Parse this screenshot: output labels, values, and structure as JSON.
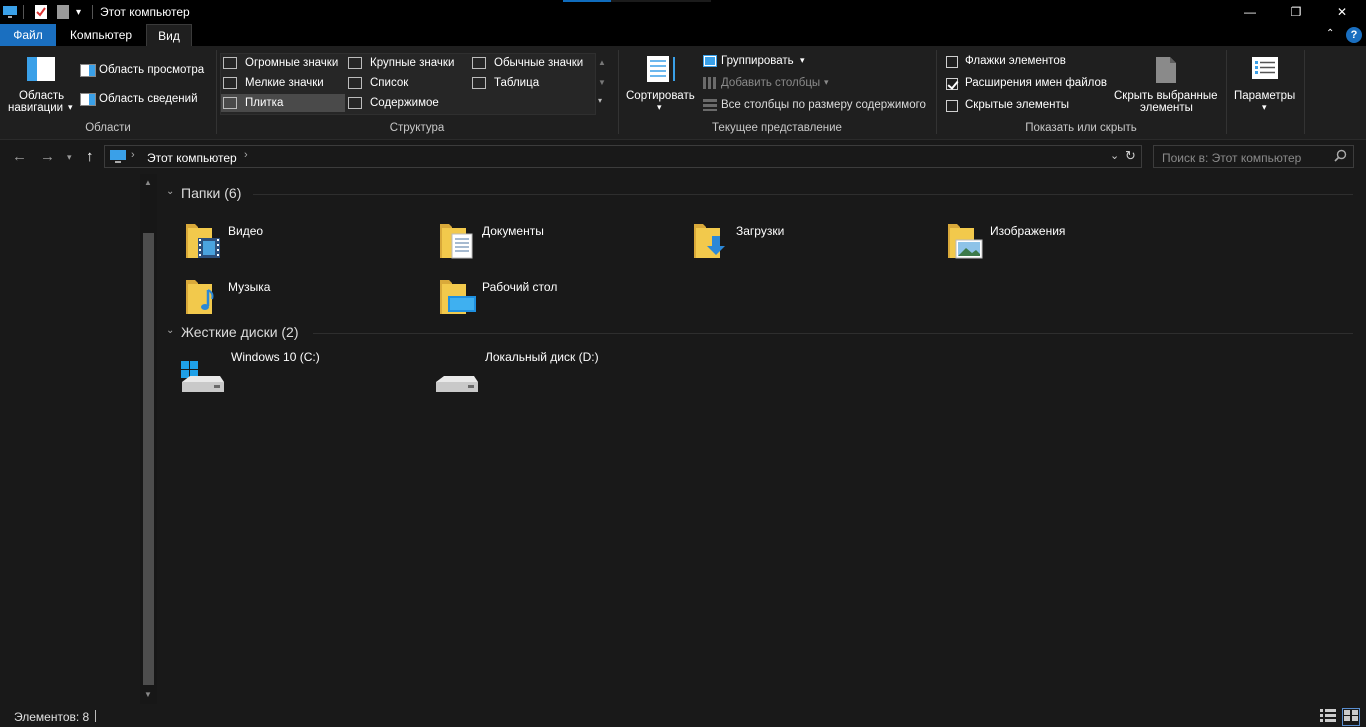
{
  "window": {
    "title": "Этот компьютер",
    "minimize_glyph": "—",
    "maximize_glyph": "❐",
    "close_glyph": "✕"
  },
  "ribbon_tabs": {
    "file": "Файл",
    "computer": "Компьютер",
    "view": "Вид"
  },
  "ribbon": {
    "areas": {
      "nav_pane_line1": "Область",
      "nav_pane_line2": "навигации",
      "preview_pane": "Область просмотра",
      "details_pane": "Область сведений",
      "label": "Области"
    },
    "layout": {
      "items": {
        "huge": "Огромные значки",
        "large": "Крупные значки",
        "medium": "Обычные значки",
        "small": "Мелкие значки",
        "list": "Список",
        "table": "Таблица",
        "tiles": "Плитка",
        "content": "Содержимое"
      },
      "selected": "tiles",
      "label": "Структура"
    },
    "current_view": {
      "sort": "Сортировать",
      "group": "Группировать",
      "add_columns": "Добавить столбцы",
      "fit_columns": "Все столбцы по размеру содержимого",
      "label": "Текущее представление"
    },
    "show_hide": {
      "item_checkboxes": "Флажки элементов",
      "item_checkboxes_checked": false,
      "file_extensions": "Расширения имен файлов",
      "file_extensions_checked": true,
      "hidden_items": "Скрытые элементы",
      "hidden_items_checked": false,
      "hide_selected_line1": "Скрыть выбранные",
      "hide_selected_line2": "элементы",
      "label": "Показать или скрыть"
    },
    "options": {
      "label": "Параметры"
    }
  },
  "address": {
    "path": "Этот компьютер",
    "search_placeholder": "Поиск в: Этот компьютер"
  },
  "folders_group": {
    "title": "Папки (6)",
    "items": [
      {
        "name": "Видео",
        "icon": "video-folder-icon"
      },
      {
        "name": "Документы",
        "icon": "documents-folder-icon"
      },
      {
        "name": "Загрузки",
        "icon": "downloads-folder-icon"
      },
      {
        "name": "Изображения",
        "icon": "pictures-folder-icon"
      },
      {
        "name": "Музыка",
        "icon": "music-folder-icon"
      },
      {
        "name": "Рабочий стол",
        "icon": "desktop-folder-icon"
      }
    ]
  },
  "drives_group": {
    "title": "Жесткие диски (2)",
    "items": [
      {
        "name": "Windows 10 (C:)",
        "icon": "system-drive-icon"
      },
      {
        "name": "Локальный диск (D:)",
        "icon": "local-drive-icon"
      }
    ]
  },
  "status": {
    "items_count": "Элементов: 8"
  },
  "colors": {
    "accent": "#1a6fc0",
    "folder": "#f2c94c",
    "background": "#191919"
  }
}
